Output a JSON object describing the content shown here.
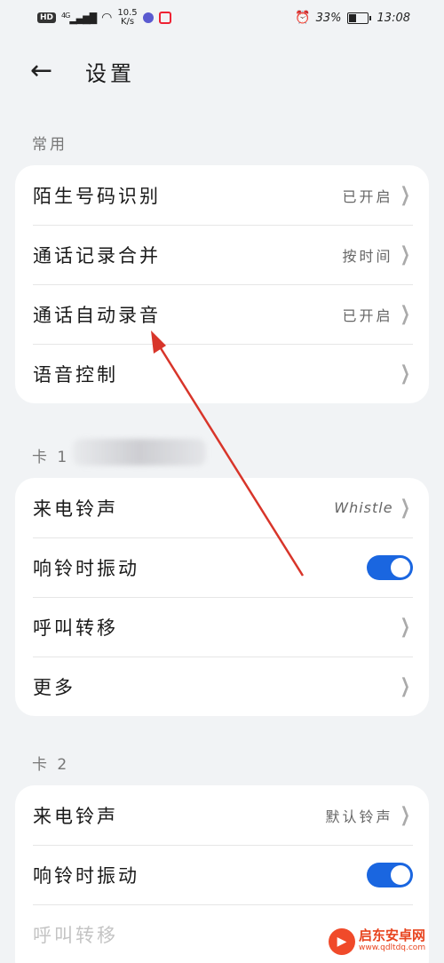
{
  "status_bar": {
    "hd": "HD",
    "network": "4G",
    "speed_value": "10.5",
    "speed_unit": "K/s",
    "battery": "33%",
    "time": "13:08"
  },
  "header": {
    "title": "设置"
  },
  "sections": [
    {
      "label": "常用",
      "items": [
        {
          "label": "陌生号码识别",
          "value": "已开启"
        },
        {
          "label": "通话记录合并",
          "value": "按时间"
        },
        {
          "label": "通话自动录音",
          "value": "已开启"
        },
        {
          "label": "语音控制",
          "value": ""
        }
      ]
    },
    {
      "label": "卡 1",
      "items": [
        {
          "label": "来电铃声",
          "value": "Whistle"
        },
        {
          "label": "响铃时振动",
          "toggle": true
        },
        {
          "label": "呼叫转移",
          "value": ""
        },
        {
          "label": "更多",
          "value": ""
        }
      ]
    },
    {
      "label": "卡 2",
      "items": [
        {
          "label": "来电铃声",
          "value": "默认铃声"
        },
        {
          "label": "响铃时振动",
          "toggle": true
        },
        {
          "label": "呼叫转移",
          "value": ""
        }
      ]
    }
  ],
  "watermark": {
    "main": "启东安卓网",
    "sub": "www.qdltdq.com"
  },
  "colors": {
    "toggle_on": "#1a66e0",
    "annotation_arrow": "#d8352a",
    "watermark": "#e8441f"
  }
}
